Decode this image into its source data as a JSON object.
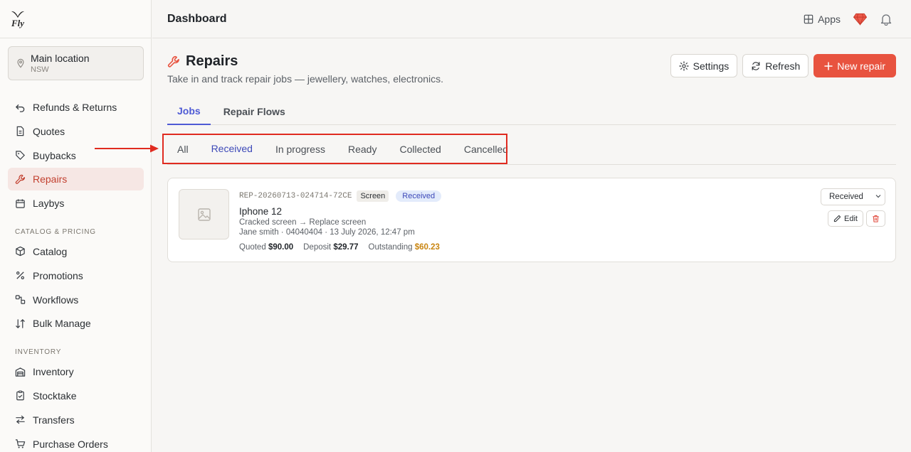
{
  "brand": {
    "logo_text": "Fly"
  },
  "header": {
    "title": "Dashboard",
    "apps_label": "Apps"
  },
  "location": {
    "name": "Main location",
    "region": "NSW"
  },
  "sidebar": {
    "items": [
      {
        "label": "Refunds & Returns",
        "icon": "undo-icon"
      },
      {
        "label": "Quotes",
        "icon": "document-icon"
      },
      {
        "label": "Buybacks",
        "icon": "tag-icon"
      },
      {
        "label": "Repairs",
        "icon": "wrench-icon",
        "active": true
      }
    ],
    "items2": [
      {
        "label": "Laybys",
        "icon": "calendar-icon"
      }
    ],
    "section_catalog": "CATALOG & PRICING",
    "catalog_items": [
      {
        "label": "Catalog",
        "icon": "box-icon"
      },
      {
        "label": "Promotions",
        "icon": "percent-icon"
      },
      {
        "label": "Workflows",
        "icon": "workflow-icon"
      },
      {
        "label": "Bulk Manage",
        "icon": "sort-icon"
      }
    ],
    "section_inventory": "INVENTORY",
    "inventory_items": [
      {
        "label": "Inventory",
        "icon": "warehouse-icon"
      },
      {
        "label": "Stocktake",
        "icon": "clipboard-icon"
      },
      {
        "label": "Transfers",
        "icon": "transfer-icon"
      },
      {
        "label": "Purchase Orders",
        "icon": "cart-icon"
      }
    ]
  },
  "page": {
    "title": "Repairs",
    "subtitle": "Take in and track repair jobs — jewellery, watches, electronics.",
    "settings_label": "Settings",
    "refresh_label": "Refresh",
    "new_label": "New repair"
  },
  "tabs": [
    "Jobs",
    "Repair Flows"
  ],
  "subtabs": [
    "All",
    "Received",
    "In progress",
    "Ready",
    "Collected",
    "Cancelled"
  ],
  "job": {
    "ref": "REP-20260713-024714-72CE",
    "category": "Screen",
    "status": "Received",
    "device": "Iphone 12",
    "issue": "Cracked screen → Replace screen",
    "customer": "Jane smith · 04040404 · 13 July 2026, 12:47 pm",
    "quoted_label": "Quoted",
    "quoted": "$90.00",
    "deposit_label": "Deposit",
    "deposit": "$29.77",
    "outstanding_label": "Outstanding",
    "outstanding": "$60.23",
    "select_value": "Received",
    "edit_label": "Edit"
  },
  "colors": {
    "accent": "#e8533f",
    "primary_tab": "#4f5bd5",
    "outstanding": "#c98510"
  }
}
